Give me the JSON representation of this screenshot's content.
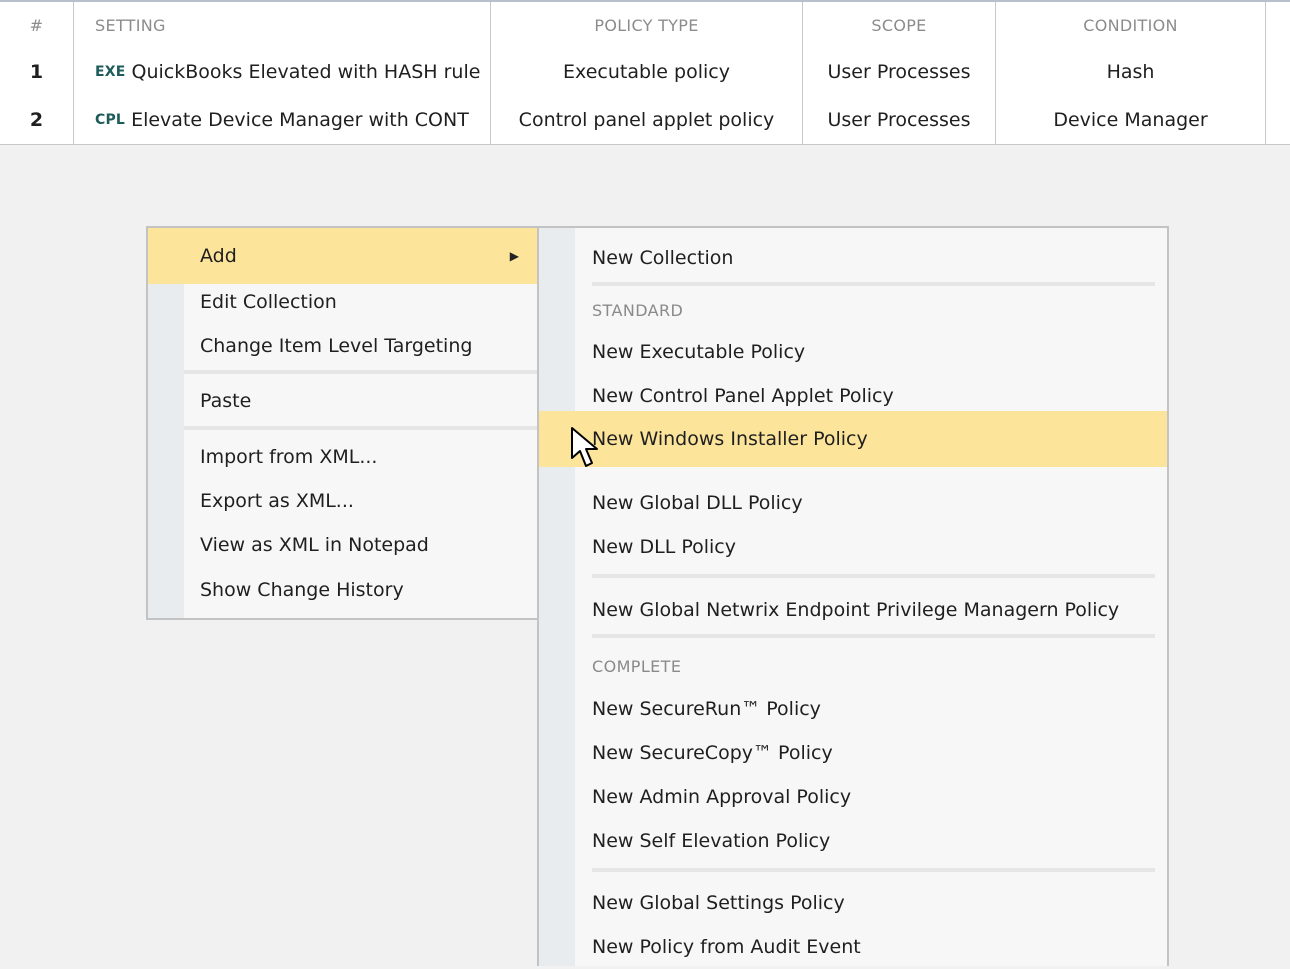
{
  "table": {
    "headers": [
      "#",
      "SETTING",
      "POLICY TYPE",
      "SCOPE",
      "CONDITION"
    ],
    "rows": [
      {
        "num": "1",
        "tag": "EXE",
        "setting": "QuickBooks Elevated with HASH rule",
        "policy_type": "Executable policy",
        "scope": "User Processes",
        "condition": "Hash"
      },
      {
        "num": "2",
        "tag": "CPL",
        "setting": "Elevate Device Manager with CONT",
        "policy_type": "Control panel applet policy",
        "scope": "User Processes",
        "condition": "Device Manager"
      }
    ]
  },
  "context_menu": {
    "items": [
      {
        "label": "Add",
        "has_submenu": true,
        "highlighted": true
      },
      {
        "label": "Edit Collection"
      },
      {
        "label": "Change Item Level Targeting"
      },
      {
        "label": "Paste"
      },
      {
        "label": "Import from XML..."
      },
      {
        "label": "Export as XML..."
      },
      {
        "label": "View as XML in Notepad"
      },
      {
        "label": "Show Change History"
      }
    ],
    "submenu_arrow": "▶"
  },
  "submenu": {
    "new_collection": "New Collection",
    "standard_header": "STANDARD",
    "standard_items": [
      "New Executable Policy",
      "New Control Panel Applet Policy",
      "New Windows Installer Policy",
      "New Global DLL Policy",
      "New DLL Policy"
    ],
    "highlighted_item": "New Windows Installer Policy",
    "global_netwrix": "New Global Netwrix Endpoint Privilege Managern Policy",
    "complete_header": "COMPLETE",
    "complete_items": [
      "New SecureRun™ Policy",
      "New SecureCopy™ Policy",
      "New Admin Approval Policy",
      "New Self Elevation Policy"
    ],
    "bottom_items": [
      "New Global Settings Policy",
      "New Policy from Audit Event"
    ]
  },
  "colors": {
    "highlight": "#fde49b",
    "background": "#f1f1f1",
    "type_tag": "#1e5c5a",
    "header_text": "#8c8c8c"
  },
  "icons": {
    "cursor": "mouse-pointer-icon",
    "submenu_arrow": "triangle-right-icon"
  }
}
